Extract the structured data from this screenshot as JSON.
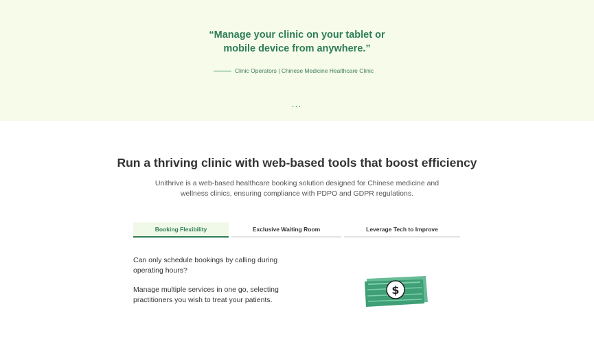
{
  "testimonial": {
    "quote_line1": "“Manage your clinic on your tablet or",
    "quote_line2": "mobile device from anywhere.”",
    "attribution": "Clinic Operators | Chinese Medicine Healthcare Clinic",
    "more_indicator": "..."
  },
  "section": {
    "heading": "Run a thriving clinic with web-based tools that boost efficiency",
    "description_line1": "Unithrive is a web-based healthcare booking solution designed for Chinese medicine and",
    "description_line2": "wellness clinics, ensuring compliance with PDPO and GDPR regulations."
  },
  "tabs": [
    {
      "label": "Booking Flexibility",
      "active": true
    },
    {
      "label": "Exclusive Waiting Room",
      "active": false
    },
    {
      "label": "Leverage Tech to Improve",
      "active": false
    }
  ],
  "panel": {
    "paragraph1": "Can only schedule bookings by calling during operating hours?",
    "paragraph2": "Manage multiple services in one go, selecting practitioners you wish to treat your patients.",
    "illustration_icon": "money-bill-icon",
    "dollar_symbol": "$"
  },
  "colors": {
    "hero_background": "#f6fbea",
    "accent_green": "#2e7d57",
    "bill_green": "#4caf84"
  }
}
